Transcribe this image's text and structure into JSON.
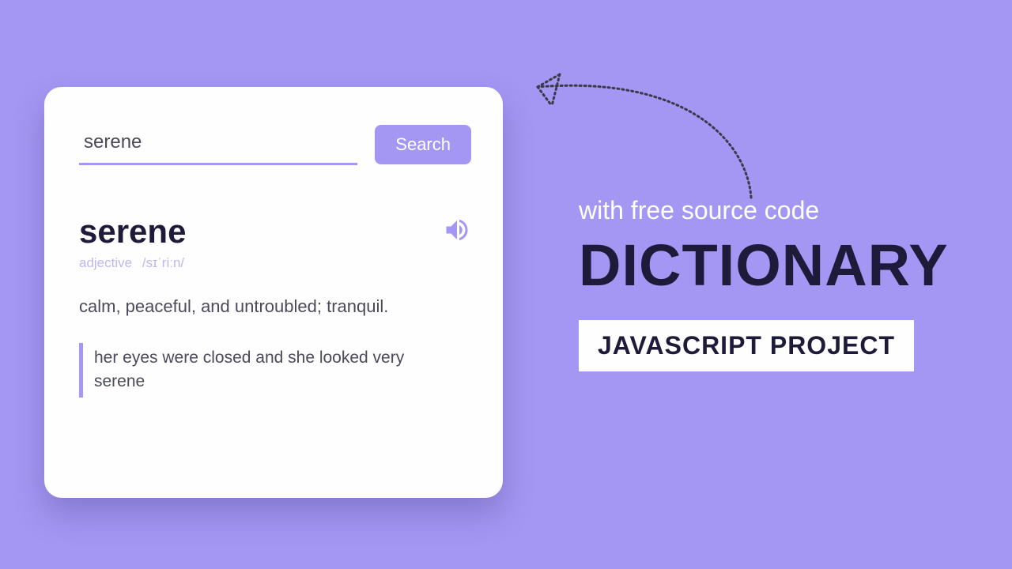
{
  "search": {
    "value": "serene",
    "button_label": "Search"
  },
  "entry": {
    "word": "serene",
    "part_of_speech": "adjective",
    "pronunciation": "/sɪˈriːn/",
    "definition": "calm, peaceful, and untroubled; tranquil.",
    "example": "her eyes were closed and she looked very serene"
  },
  "promo": {
    "subtitle": "with free source code",
    "title": "DICTIONARY",
    "badge": "JAVASCRIPT PROJECT"
  },
  "colors": {
    "accent": "#a497f4",
    "dark": "#1e1a3a"
  }
}
